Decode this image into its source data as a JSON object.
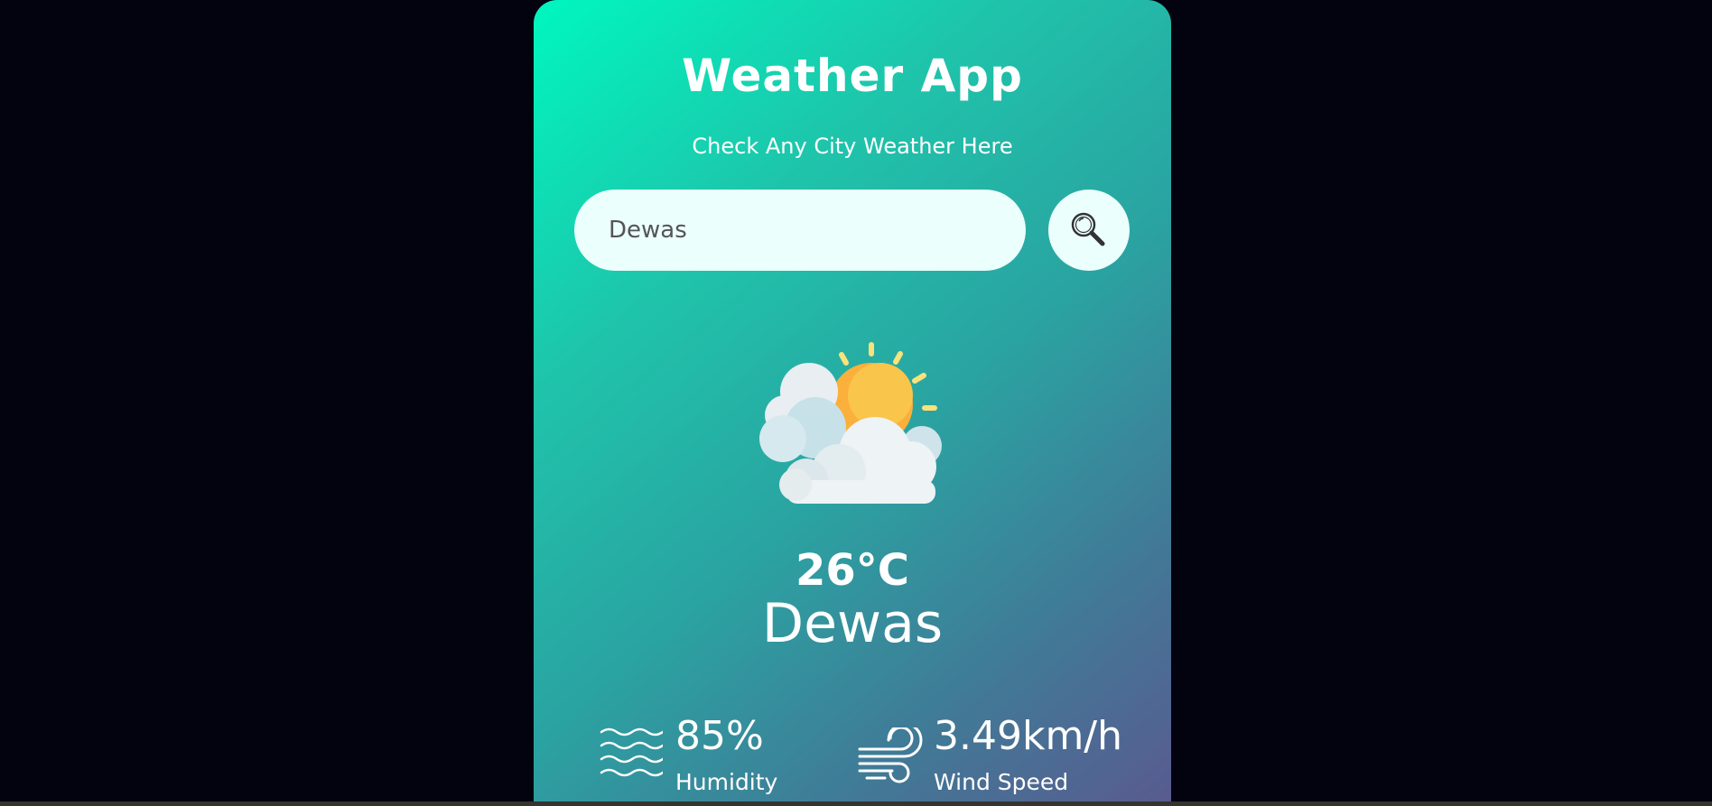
{
  "app": {
    "title": "Weather App",
    "subtitle": "Check Any City Weather Here"
  },
  "search": {
    "value": "Dewas",
    "placeholder": "",
    "button_icon": "search-icon"
  },
  "weather": {
    "condition_icon": "partly-cloudy-icon",
    "temperature": "26°C",
    "city": "Dewas"
  },
  "details": {
    "humidity": {
      "icon": "humidity-waves-icon",
      "value": "85%",
      "label": "Humidity"
    },
    "wind": {
      "icon": "wind-icon",
      "value": "3.49km/h",
      "label": "Wind Speed"
    }
  },
  "colors": {
    "background": "#03020f",
    "card_gradient_start": "#00f7bf",
    "card_gradient_end": "#595b90",
    "input_background": "#ebfffc",
    "text": "#ffffff"
  }
}
